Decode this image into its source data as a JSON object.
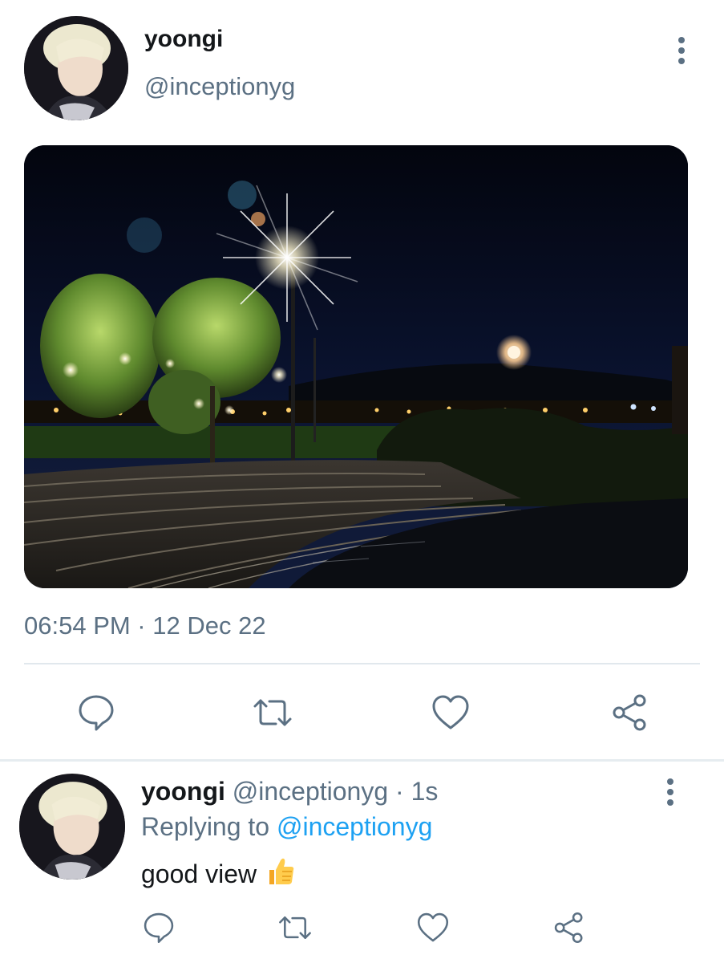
{
  "tweet": {
    "author_name": "yoongi",
    "author_handle": "@inceptionyg",
    "timestamp": "06:54 PM · 12 Dec 22"
  },
  "reply": {
    "author_name": "yoongi",
    "author_handle": "@inceptionyg",
    "separator": "·",
    "time": "1s",
    "replying_label": "Replying to",
    "replying_handle": "@inceptionyg",
    "text": "good view"
  },
  "icons": {
    "more": "more-vertical-icon",
    "reply": "reply-icon",
    "retweet": "retweet-icon",
    "like": "like-icon",
    "share": "share-icon",
    "emoji": "thumbs-up-emoji"
  },
  "colors": {
    "text": "#14171a",
    "secondary": "#5b7083",
    "link": "#1da1f2",
    "divider": "#e1e8ed"
  }
}
